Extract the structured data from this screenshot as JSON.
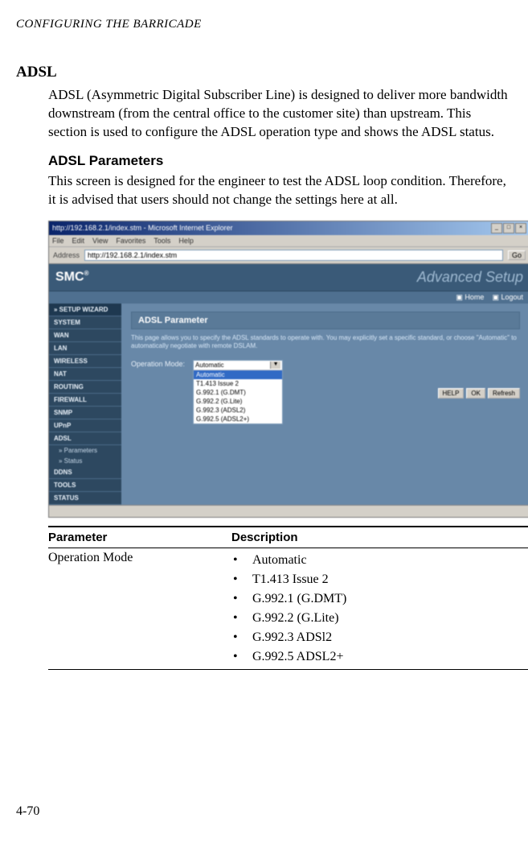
{
  "runningHeader": "CONFIGURING THE BARRICADE",
  "sectionTitle": "ADSL",
  "intro": "ADSL (Asymmetric Digital Subscriber Line) is designed to deliver more bandwidth downstream (from the central office to the customer site) than upstream. This section is used to configure the ADSL operation type and shows the ADSL status.",
  "subsectionTitle": "ADSL Parameters",
  "subsectionDesc": "This screen is designed for the engineer to test the ADSL loop condition. Therefore, it is advised that users should not change the settings here at all.",
  "ie": {
    "title": "http://192.168.2.1/index.stm - Microsoft Internet Explorer",
    "menu": [
      "File",
      "Edit",
      "View",
      "Favorites",
      "Tools",
      "Help"
    ],
    "addrLabel": "Address",
    "addrValue": "http://192.168.2.1/index.stm",
    "goLabel": "Go"
  },
  "router": {
    "brand": "SMC",
    "brandSup": "®",
    "pageTitle": "Advanced Setup",
    "utilHome": "Home",
    "utilLogout": "Logout",
    "sidebar": {
      "wizard": "» SETUP WIZARD",
      "items": [
        "SYSTEM",
        "WAN",
        "LAN",
        "WIRELESS",
        "NAT",
        "ROUTING",
        "FIREWALL",
        "SNMP",
        "UPnP",
        "ADSL"
      ],
      "subs": [
        "» Parameters",
        "» Status"
      ],
      "items2": [
        "DDNS",
        "TOOLS",
        "STATUS"
      ]
    },
    "panelTitle": "ADSL Parameter",
    "panelDesc": "This page allows you to specify the ADSL standards to operate with. You may explicitly set a specific standard, or choose \"Automatic\" to automatically negotiate with remote DSLAM.",
    "opModeLabel": "Operation Mode:",
    "opModeSelected": "Automatic",
    "opModeOptions": [
      "Automatic",
      "T1.413 Issue 2",
      "G.992.1 (G.DMT)",
      "G.992.2 (G.Lite)",
      "G.992.3 (ADSL2)",
      "G.992.5 (ADSL2+)"
    ],
    "btnHelp": "HELP",
    "btnOk": "OK",
    "btnRefresh": "Refresh"
  },
  "table": {
    "colParam": "Parameter",
    "colDesc": "Description",
    "paramName": "Operation Mode",
    "descItems": [
      "Automatic",
      "T1.413 Issue 2",
      "G.992.1 (G.DMT)",
      "G.992.2 (G.Lite)",
      "G.992.3 ADSl2",
      "G.992.5 ADSL2+"
    ]
  },
  "pageNumber": "4-70"
}
